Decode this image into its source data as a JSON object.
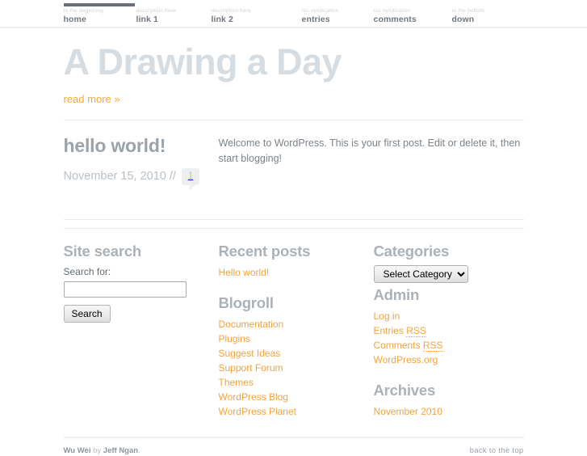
{
  "nav": {
    "items": [
      {
        "description": "to the beginning",
        "label": "home",
        "active": true
      },
      {
        "description": "description here",
        "label": "link 1",
        "active": false
      },
      {
        "description": "description here",
        "label": "link 2",
        "active": false
      },
      {
        "description": "rss syndication",
        "label": "entries",
        "active": false
      },
      {
        "description": "rss syndication",
        "label": "comments",
        "active": false
      },
      {
        "description": "to the bottom",
        "label": "down",
        "active": false
      }
    ]
  },
  "header": {
    "title": "A Drawing a Day",
    "read_more": "read more »"
  },
  "post": {
    "title": "hello world!",
    "date": "November 15, 2010 //",
    "comment_count": "1",
    "body": "Welcome to WordPress. This is your first post. Edit or delete it, then start blogging!"
  },
  "widgets": {
    "site_search": {
      "title": "Site search",
      "label": "Search for:",
      "value": "",
      "placeholder": "",
      "button": "Search"
    },
    "recent_posts": {
      "title": "Recent posts",
      "items": [
        {
          "label": "Hello world!"
        }
      ]
    },
    "blogroll": {
      "title": "Blogroll",
      "items": [
        {
          "label": "Documentation"
        },
        {
          "label": "Plugins"
        },
        {
          "label": "Suggest Ideas"
        },
        {
          "label": "Support Forum"
        },
        {
          "label": "Themes"
        },
        {
          "label": "WordPress Blog"
        },
        {
          "label": "WordPress Planet"
        }
      ]
    },
    "categories": {
      "title": "Categories",
      "selected": "Select Category",
      "options": [
        "Select Category"
      ]
    },
    "admin": {
      "title": "Admin",
      "items": [
        {
          "label": "Log in",
          "abbr": ""
        },
        {
          "label": "Entries ",
          "abbr": "RSS"
        },
        {
          "label": "Comments ",
          "abbr": "RSS"
        },
        {
          "label": "WordPress.org",
          "abbr": ""
        }
      ]
    },
    "archives": {
      "title": "Archives",
      "items": [
        {
          "label": "November 2010"
        }
      ]
    }
  },
  "footer": {
    "theme_name": "Wu Wei",
    "by": " by ",
    "author": "Jeff Ngan",
    "period": ".",
    "back_to_top": "back to the top"
  },
  "colors": {
    "accent": "#f2a33e",
    "heading": "#aab2b8",
    "title": "#d6dde2",
    "text": "#7b848b",
    "rule": "#e7eaec",
    "nav_active": "#697079"
  }
}
